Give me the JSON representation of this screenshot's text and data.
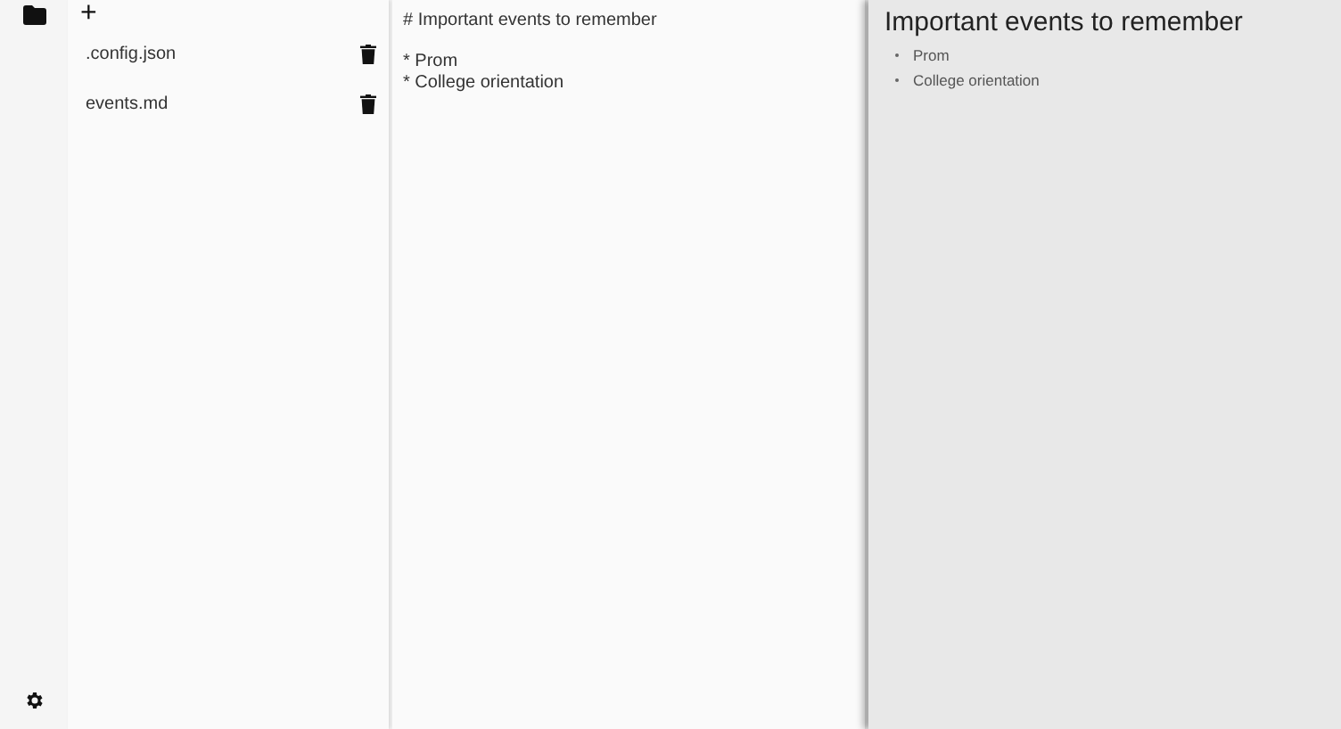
{
  "file_list": {
    "add_label": "+",
    "files": [
      {
        "name": ".config.json"
      },
      {
        "name": "events.md"
      }
    ]
  },
  "editor": {
    "text": "# Important events to remember\n\n* Prom\n* College orientation"
  },
  "preview": {
    "heading": "Important events to remember",
    "bullets": [
      "Prom",
      "College orientation"
    ]
  }
}
